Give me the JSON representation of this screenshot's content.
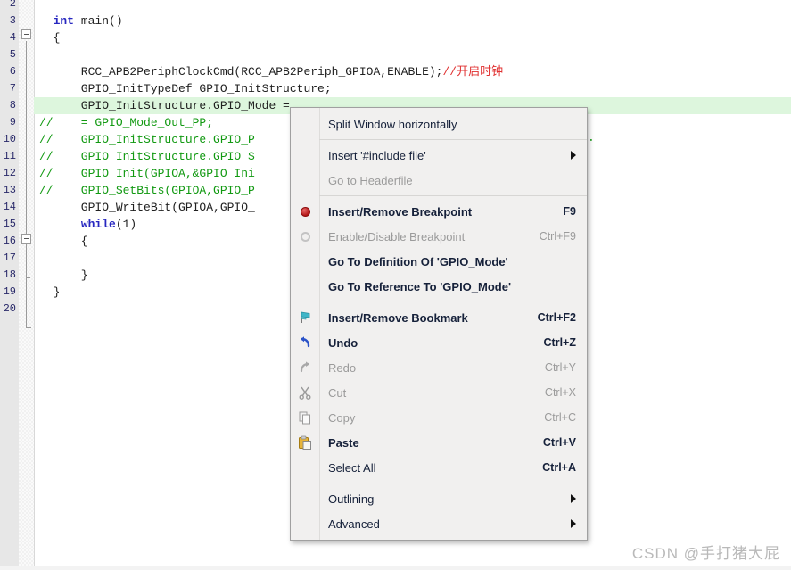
{
  "editor": {
    "lines": [
      {
        "no": "2",
        "segments": [],
        "highlight": false
      },
      {
        "no": "3",
        "segments": [
          {
            "t": "  ",
            "c": "plain"
          },
          {
            "t": "int",
            "c": "kw"
          },
          {
            "t": " main()",
            "c": "plain"
          }
        ],
        "highlight": false
      },
      {
        "no": "4",
        "segments": [
          {
            "t": "  {",
            "c": "plain"
          }
        ],
        "highlight": false
      },
      {
        "no": "5",
        "segments": [],
        "highlight": false
      },
      {
        "no": "6",
        "segments": [
          {
            "t": "      RCC_APB2PeriphClockCmd(RCC_APB2Periph_GPIOA,ENABLE);",
            "c": "plain"
          },
          {
            "t": "//开启时钟",
            "c": "cmtcn"
          }
        ],
        "highlight": false
      },
      {
        "no": "7",
        "segments": [
          {
            "t": "      GPIO_InitTypeDef GPIO_InitStructure;",
            "c": "plain"
          }
        ],
        "highlight": false
      },
      {
        "no": "8",
        "segments": [
          {
            "t": "      GPIO_InitStructure.GPIO_Mode =",
            "c": "plain"
          }
        ],
        "highlight": true
      },
      {
        "no": "9",
        "segments": [
          {
            "t": "//    = GPIO_Mode_Out_PP;",
            "c": "cmt"
          }
        ],
        "highlight": false
      },
      {
        "no": "10",
        "segments": [
          {
            "t": "//    GPIO_InitStructure.GPIO_P",
            "c": "cmt"
          }
        ],
        "highlight": false
      },
      {
        "no": "11",
        "segments": [
          {
            "t": "//    GPIO_InitStructure.GPIO_S",
            "c": "cmt"
          }
        ],
        "highlight": false
      },
      {
        "no": "12",
        "segments": [
          {
            "t": "//    GPIO_Init(GPIOA,&GPIO_Ini",
            "c": "cmt"
          }
        ],
        "highlight": false
      },
      {
        "no": "13",
        "segments": [
          {
            "t": "//    GPIO_SetBits(GPIOA,GPIO_P",
            "c": "cmt"
          }
        ],
        "highlight": false
      },
      {
        "no": "14",
        "segments": [
          {
            "t": "      GPIO_WriteBit(GPIOA,GPIO_",
            "c": "plain"
          }
        ],
        "highlight": false
      },
      {
        "no": "15",
        "segments": [
          {
            "t": "      ",
            "c": "plain"
          },
          {
            "t": "while",
            "c": "kw"
          },
          {
            "t": "(1)",
            "c": "plain"
          }
        ],
        "highlight": false
      },
      {
        "no": "16",
        "segments": [
          {
            "t": "      {",
            "c": "plain"
          }
        ],
        "highlight": false
      },
      {
        "no": "17",
        "segments": [],
        "highlight": false
      },
      {
        "no": "18",
        "segments": [
          {
            "t": "      }",
            "c": "plain"
          }
        ],
        "highlight": false
      },
      {
        "no": "19",
        "segments": [
          {
            "t": "  }",
            "c": "plain"
          }
        ],
        "highlight": false
      },
      {
        "no": "20",
        "segments": [],
        "highlight": false
      }
    ],
    "highlight_color": "#ddf6dd",
    "keyword_color": "#2727c0",
    "comment_color": "#119911",
    "chinese_comment_color": "#e03030"
  },
  "context_menu": {
    "groups": [
      {
        "items": [
          {
            "label": "Split Window horizontally",
            "accel": "",
            "icon": "",
            "disabled": false,
            "bold": false,
            "submenu": false
          }
        ]
      },
      {
        "items": [
          {
            "label": "Insert '#include file'",
            "accel": "",
            "icon": "",
            "disabled": false,
            "bold": false,
            "submenu": true
          },
          {
            "label": "Go to Headerfile",
            "accel": "",
            "icon": "",
            "disabled": true,
            "bold": false,
            "submenu": false
          }
        ]
      },
      {
        "items": [
          {
            "label": "Insert/Remove Breakpoint",
            "accel": "F9",
            "icon": "breakpoint-red-dot-icon",
            "disabled": false,
            "bold": true,
            "submenu": false
          },
          {
            "label": "Enable/Disable Breakpoint",
            "accel": "Ctrl+F9",
            "icon": "breakpoint-hollow-circle-icon",
            "disabled": true,
            "bold": false,
            "submenu": false
          },
          {
            "label": "Go To Definition Of 'GPIO_Mode'",
            "accel": "",
            "icon": "",
            "disabled": false,
            "bold": true,
            "submenu": false
          },
          {
            "label": "Go To Reference To 'GPIO_Mode'",
            "accel": "",
            "icon": "",
            "disabled": false,
            "bold": true,
            "submenu": false
          }
        ]
      },
      {
        "items": [
          {
            "label": "Insert/Remove Bookmark",
            "accel": "Ctrl+F2",
            "icon": "bookmark-flag-icon",
            "disabled": false,
            "bold": true,
            "submenu": false
          },
          {
            "label": "Undo",
            "accel": "Ctrl+Z",
            "icon": "undo-arrow-icon",
            "disabled": false,
            "bold": true,
            "submenu": false
          },
          {
            "label": "Redo",
            "accel": "Ctrl+Y",
            "icon": "redo-arrow-icon",
            "disabled": true,
            "bold": false,
            "submenu": false
          },
          {
            "label": "Cut",
            "accel": "Ctrl+X",
            "icon": "scissors-icon",
            "disabled": true,
            "bold": false,
            "submenu": false
          },
          {
            "label": "Copy",
            "accel": "Ctrl+C",
            "icon": "copy-pages-icon",
            "disabled": true,
            "bold": false,
            "submenu": false
          },
          {
            "label": "Paste",
            "accel": "Ctrl+V",
            "icon": "clipboard-paste-icon",
            "disabled": false,
            "bold": true,
            "submenu": false
          },
          {
            "label": "Select All",
            "accel": "Ctrl+A",
            "icon": "",
            "disabled": false,
            "bold": false,
            "submenu": false
          }
        ]
      },
      {
        "items": [
          {
            "label": "Outlining",
            "accel": "",
            "icon": "",
            "disabled": false,
            "bold": false,
            "submenu": true
          },
          {
            "label": "Advanced",
            "accel": "",
            "icon": "",
            "disabled": false,
            "bold": false,
            "submenu": true
          }
        ]
      }
    ]
  },
  "watermark": {
    "text": "CSDN @手打猪大屁"
  }
}
